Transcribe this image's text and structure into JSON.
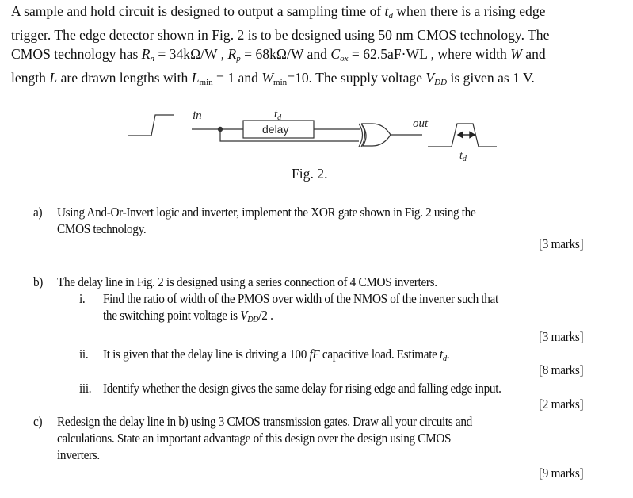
{
  "intro": {
    "line1_a": "A sample and hold circuit is designed to output a sampling time of ",
    "line1_td_t": "t",
    "line1_td_d": "d",
    "line1_b": " when there is a rising edge",
    "line2": "trigger. The edge detector shown in Fig. 2 is to be designed using 50 nm CMOS technology. The",
    "line3_a": "CMOS technology has ",
    "rn_symbol": "R",
    "rn_sub": "n",
    "rn_value": " = 34kΩ/W",
    "sep1": " , ",
    "rp_symbol": "R",
    "rp_sub": "p",
    "rp_value": " = 68kΩ/W",
    "line3_b": " and ",
    "cox_symbol": "C",
    "cox_sub": "ox",
    "cox_value": " = 62.5aF·WL",
    "line3_c": " , where width ",
    "w_symbol": "W",
    "line3_d": " and",
    "line4_a": "length ",
    "l_symbol": "L",
    "line4_b": " are drawn lengths with ",
    "lmin_symbol": "L",
    "lmin_sub": "min",
    "lmin_value": " = 1 and ",
    "wmin_symbol": "W",
    "wmin_sub": "min",
    "wmin_value": "=10. The supply voltage ",
    "vdd_symbol": "V",
    "vdd_sub": "DD",
    "line4_c": " is given as 1 V."
  },
  "figure": {
    "in_label": "in",
    "td_top_t": "t",
    "td_top_d": "d",
    "delay_label": "delay",
    "out_label": "out",
    "td_bottom_t": "t",
    "td_bottom_d": "d",
    "caption": "Fig. 2."
  },
  "questions": {
    "a": {
      "label": "a)",
      "line1": "Using And-Or-Invert logic and inverter, implement the XOR gate shown in Fig. 2 using the",
      "line2": "CMOS technology.",
      "marks": "[3 marks]"
    },
    "b": {
      "label": "b)",
      "text": "The delay line in Fig. 2 is designed using a series connection of 4 CMOS inverters.",
      "i": {
        "label": "i.",
        "line1": "Find the ratio of width of the PMOS over width of the NMOS of the inverter such that",
        "line2_a": "the switching point voltage is ",
        "vdd_symbol": "V",
        "vdd_sub": "DD",
        "line2_b": "/2 .",
        "marks": "[3 marks]"
      },
      "ii": {
        "label": "ii.",
        "text_a": "It is given that the delay line is driving a 100 ",
        "unit": "fF",
        "text_b": " capacitive load. Estimate ",
        "td_t": "t",
        "td_d": "d",
        "text_c": ".",
        "marks": "[8 marks]"
      },
      "iii": {
        "label": "iii.",
        "text": "Identify whether the design gives the same delay for rising edge and falling edge input.",
        "marks": "[2 marks]"
      }
    },
    "c": {
      "label": "c)",
      "line1": "Redesign the delay line in b) using 3 CMOS transmission gates. Draw all your circuits and",
      "line2": "calculations. State an important advantage of this design over the design using CMOS",
      "line3": "inverters.",
      "marks": "[9 marks]"
    }
  }
}
